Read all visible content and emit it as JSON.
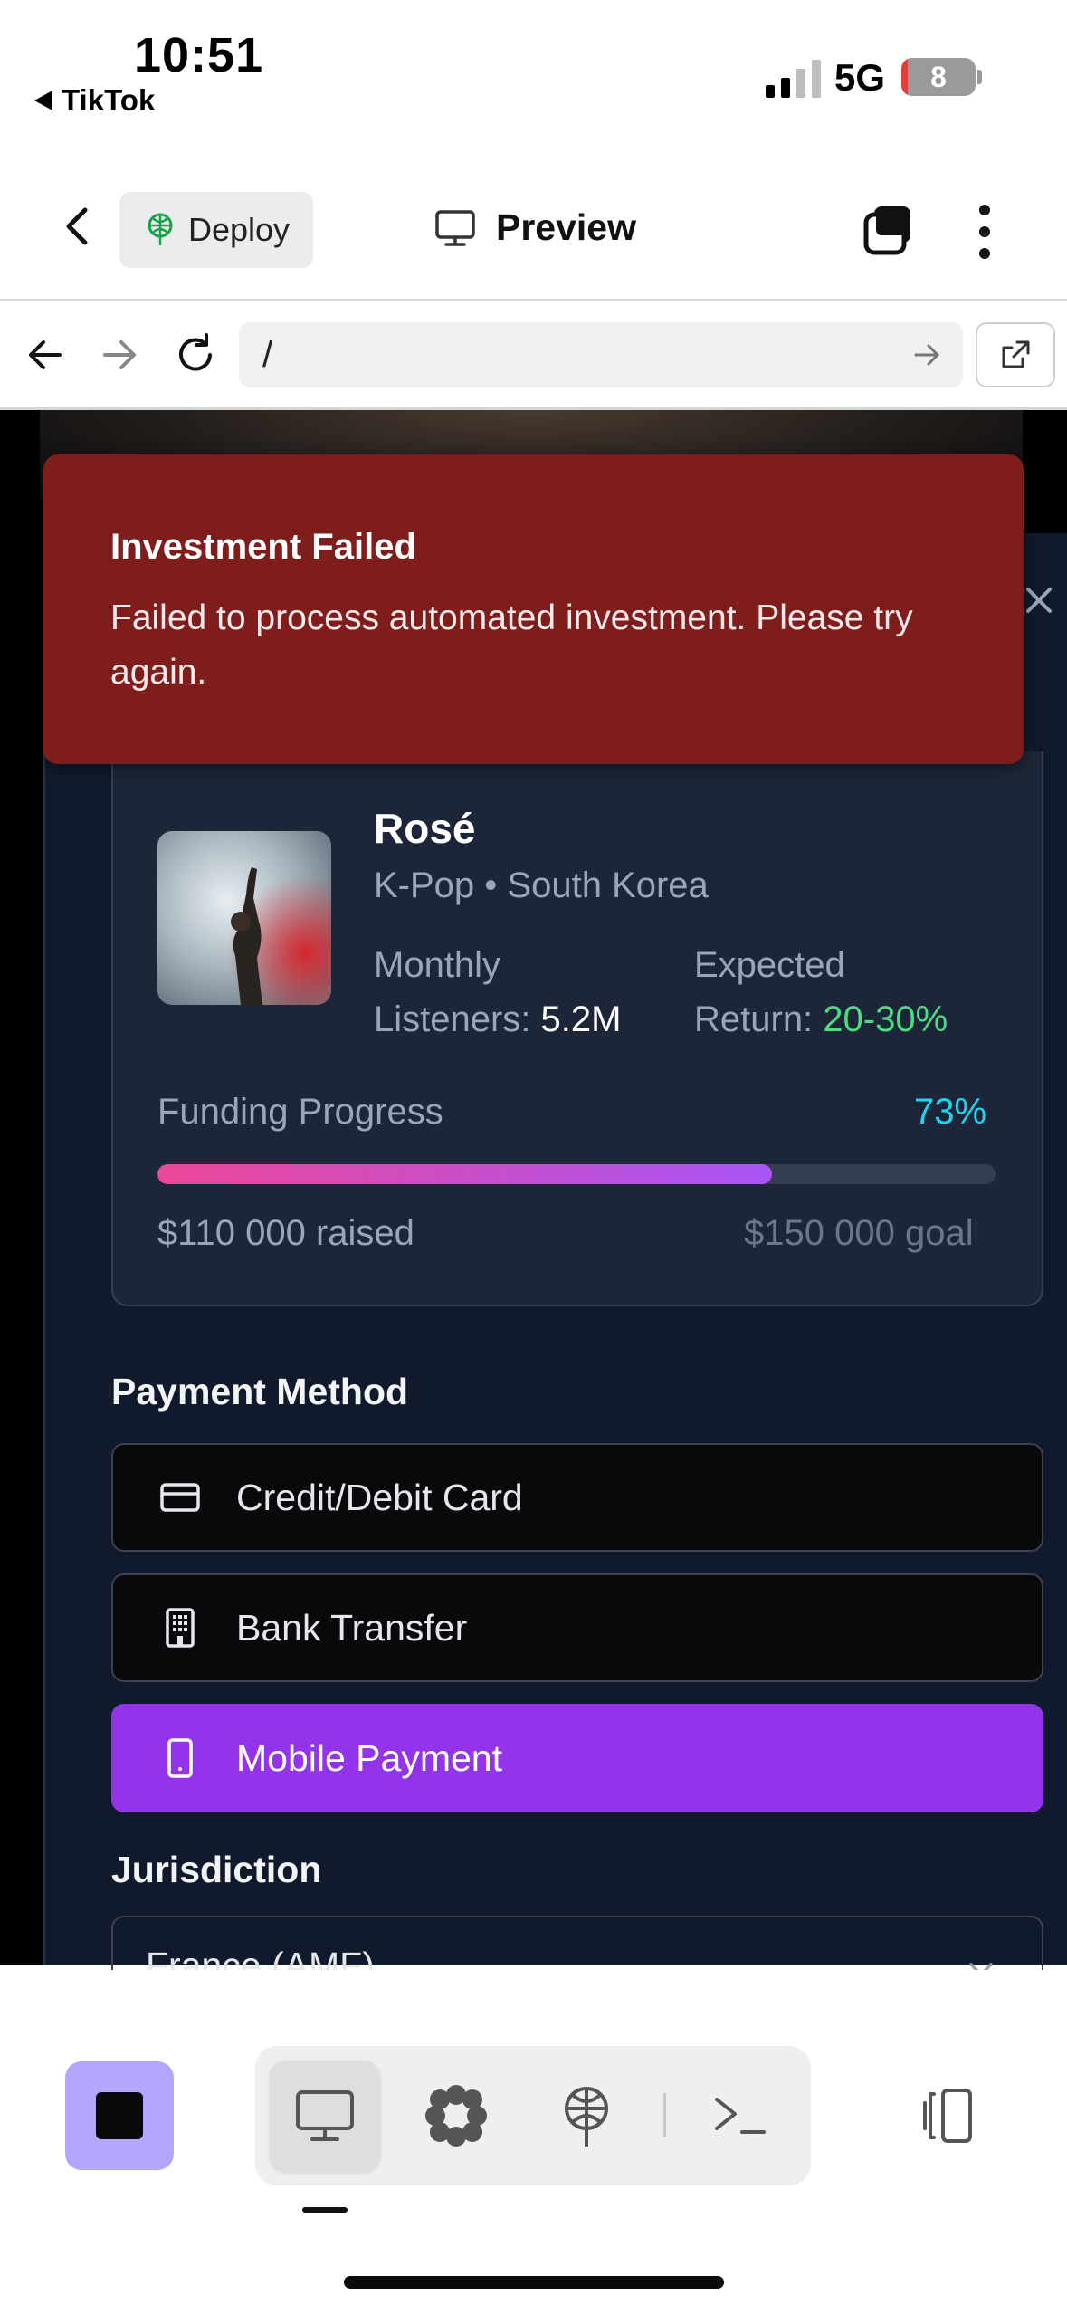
{
  "status_bar": {
    "time": "10:51",
    "back_app": "TikTok",
    "network": "5G",
    "battery": "8",
    "battery_level": 0.08,
    "signal_bars": 2,
    "colors": {
      "battery_low": "#e0403a"
    }
  },
  "toolbar": {
    "back_icon": "chevron-left-icon",
    "deploy_label": "Deploy",
    "deploy_icon": "globe-tree-icon",
    "preview_label": "Preview",
    "preview_icon": "monitor-icon",
    "tabs_icon": "tabs-icon",
    "more_icon": "kebab-icon"
  },
  "address_bar": {
    "url": "/",
    "icons": [
      "arrow-left-icon",
      "arrow-right-icon",
      "reload-icon",
      "arrow-right-icon",
      "external-link-icon"
    ]
  },
  "toast": {
    "title": "Investment Failed",
    "message": "Failed to process automated investment. Please try again.",
    "color": "#7f1d1d"
  },
  "artist": {
    "name": "Rosé",
    "meta": "K-Pop • South Korea",
    "listeners_label_1": "Monthly",
    "listeners_label_2": "Listeners: ",
    "listeners_value": "5.2M",
    "return_label_1": "Expected",
    "return_label_2": "Return: ",
    "return_value": "20-30%",
    "funding_label": "Funding Progress",
    "funding_percent": "73%",
    "funding_fraction": 0.733,
    "raised": "$110 000 raised",
    "goal": "$150 000 goal"
  },
  "payment": {
    "title": "Payment Method",
    "options": [
      {
        "label": "Credit/Debit Card",
        "icon": "credit-card-icon",
        "selected": false
      },
      {
        "label": "Bank Transfer",
        "icon": "building-icon",
        "selected": false
      },
      {
        "label": "Mobile Payment",
        "icon": "smartphone-icon",
        "selected": true
      }
    ],
    "accent": "#9333ea"
  },
  "jurisdiction": {
    "title": "Jurisdiction",
    "value": "France (AMF)"
  },
  "bottom_bar": {
    "tools": [
      "stop-icon",
      "monitor-icon",
      "flower-icon",
      "globe-tree-icon",
      "terminal-icon",
      "split-view-icon"
    ],
    "accent": "#b3a6ff"
  }
}
